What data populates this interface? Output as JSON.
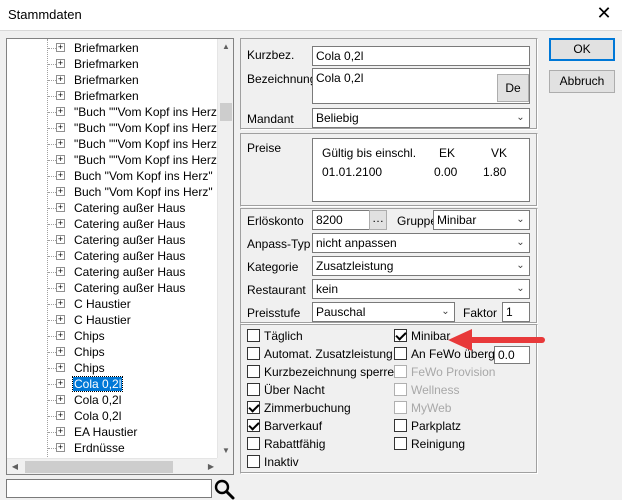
{
  "window": {
    "title": "Stammdaten",
    "close": "✕"
  },
  "buttons": {
    "ok": "OK",
    "cancel": "Abbruch",
    "de": "De",
    "konto_picker": "…"
  },
  "tree": {
    "items": [
      {
        "label": "Briefmarken",
        "selected": false
      },
      {
        "label": "Briefmarken",
        "selected": false
      },
      {
        "label": "Briefmarken",
        "selected": false
      },
      {
        "label": "Briefmarken",
        "selected": false
      },
      {
        "label": "\"Buch \"\"Vom Kopf ins Herz\"\"\"",
        "selected": false
      },
      {
        "label": "\"Buch \"\"Vom Kopf ins Herz\"\"\"",
        "selected": false
      },
      {
        "label": "\"Buch \"\"Vom Kopf ins Herz\"\"\"",
        "selected": false
      },
      {
        "label": "\"Buch \"\"Vom Kopf ins Herz\"\"\"",
        "selected": false
      },
      {
        "label": "Buch \"Vom Kopf ins Herz\"",
        "selected": false
      },
      {
        "label": "Buch \"Vom Kopf ins Herz\"",
        "selected": false
      },
      {
        "label": "Catering außer Haus",
        "selected": false
      },
      {
        "label": "Catering außer Haus",
        "selected": false
      },
      {
        "label": "Catering außer Haus",
        "selected": false
      },
      {
        "label": "Catering außer Haus",
        "selected": false
      },
      {
        "label": "Catering außer Haus",
        "selected": false
      },
      {
        "label": "Catering außer Haus",
        "selected": false
      },
      {
        "label": "C Haustier",
        "selected": false
      },
      {
        "label": "C Haustier",
        "selected": false
      },
      {
        "label": "Chips",
        "selected": false
      },
      {
        "label": "Chips",
        "selected": false
      },
      {
        "label": "Chips",
        "selected": false
      },
      {
        "label": "Cola 0,2l",
        "selected": true
      },
      {
        "label": "Cola 0,2l",
        "selected": false
      },
      {
        "label": "Cola 0,2l",
        "selected": false
      },
      {
        "label": "EA Haustier",
        "selected": false
      },
      {
        "label": "Erdnüsse",
        "selected": false
      }
    ]
  },
  "form": {
    "kurzbez_label": "Kurzbez.",
    "kurzbez_value": "Cola 0,2l",
    "bezeichnung_label": "Bezeichnung",
    "bezeichnung_value": "Cola 0,2l",
    "mandant_label": "Mandant",
    "mandant_value": "Beliebig",
    "preise_label": "Preise",
    "prices_table": {
      "headers": [
        "Gültig bis einschl.",
        "EK",
        "VK"
      ],
      "rows": [
        [
          "01.01.2100",
          "0.00",
          "1.80"
        ]
      ]
    },
    "erloeskonto_label": "Erlöskonto",
    "erloeskonto_value": "8200",
    "gruppe_label": "Gruppe",
    "gruppe_value": "Minibar",
    "anpass_label": "Anpass-Typ",
    "anpass_value": "nicht anpassen",
    "kategorie_label": "Kategorie",
    "kategorie_value": "Zusatzleistung",
    "restaurant_label": "Restaurant",
    "restaurant_value": "kein",
    "preisstufe_label": "Preisstufe",
    "preisstufe_value": "Pauschal",
    "faktor_label": "Faktor",
    "faktor_value": "1",
    "an_fewo_value": "0.0"
  },
  "checkboxes_left": [
    {
      "label": "Täglich",
      "checked": false,
      "disabled": false
    },
    {
      "label": "Automat. Zusatzleistung",
      "checked": false,
      "disabled": false
    },
    {
      "label": "Kurzbezeichnung sperren",
      "checked": false,
      "disabled": false
    },
    {
      "label": "Über Nacht",
      "checked": false,
      "disabled": false
    },
    {
      "label": "Zimmerbuchung",
      "checked": true,
      "disabled": false
    },
    {
      "label": "Barverkauf",
      "checked": true,
      "disabled": false
    },
    {
      "label": "Rabattfähig",
      "checked": false,
      "disabled": false
    },
    {
      "label": "Inaktiv",
      "checked": false,
      "disabled": false
    }
  ],
  "checkboxes_right": [
    {
      "label": "Minibar",
      "checked": true,
      "disabled": false
    },
    {
      "label": "An FeWo überg.",
      "checked": false,
      "disabled": false
    },
    {
      "label": "FeWo Provision",
      "checked": false,
      "disabled": true
    },
    {
      "label": "Wellness",
      "checked": false,
      "disabled": true
    },
    {
      "label": "MyWeb",
      "checked": false,
      "disabled": true
    },
    {
      "label": "Parkplatz",
      "checked": false,
      "disabled": false
    },
    {
      "label": "Reinigung",
      "checked": false,
      "disabled": false
    }
  ],
  "colors": {
    "selection": "#0078d7",
    "annotation_arrow": "#e8393a"
  },
  "icons": {
    "tree_expander": "plus-box-icon",
    "search": "magnifier-icon",
    "dropdown": "chevron-down-icon"
  }
}
